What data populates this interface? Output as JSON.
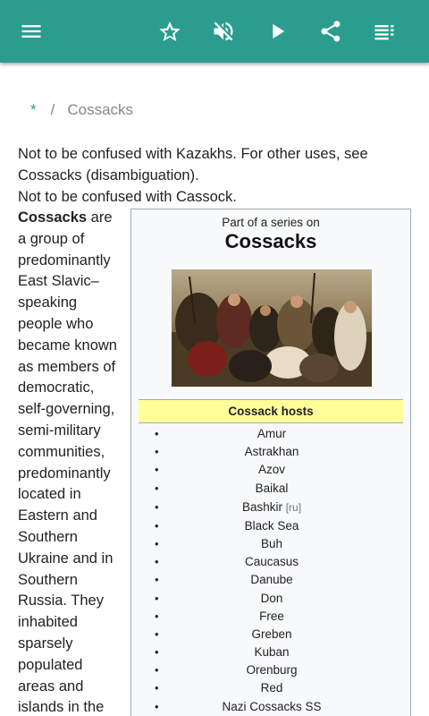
{
  "toolbar": {
    "menu_icon": "menu-icon",
    "favorite_icon": "star-outline-icon",
    "mute_icon": "volume-off-icon",
    "play_icon": "play-icon",
    "share_icon": "share-icon",
    "toc_icon": "list-icon",
    "color": "#2a9d8f"
  },
  "breadcrumb": {
    "home": "*",
    "separator": "/",
    "current": "Cossacks"
  },
  "hatnotes": [
    "Not to be confused with Kazakhs. For other uses, see Cossacks (disambiguation).",
    "Not to be confused with Cassock."
  ],
  "lead": {
    "bold": "Cossacks",
    "text": " are a group of predominantly East Slavic–speaking people who became known as members of democratic, self-governing, semi-military communities, predominantly located in Eastern and Southern Ukraine and in Southern Russia. They inhabited sparsely populated areas and islands in the"
  },
  "infobox": {
    "above": "Part of a series on",
    "title": "Cossacks",
    "header": "Cossack hosts",
    "hosts": [
      "Amur",
      "Astrakhan",
      "Azov",
      "Baikal",
      "Bashkir",
      "Black Sea",
      "Buh",
      "Caucasus",
      "Danube",
      "Don",
      "Free",
      "Greben",
      "Kuban",
      "Orenburg",
      "Red",
      "Nazi Cossacks SS"
    ],
    "interlang": "[ru]",
    "header_color": "#ffff99"
  }
}
